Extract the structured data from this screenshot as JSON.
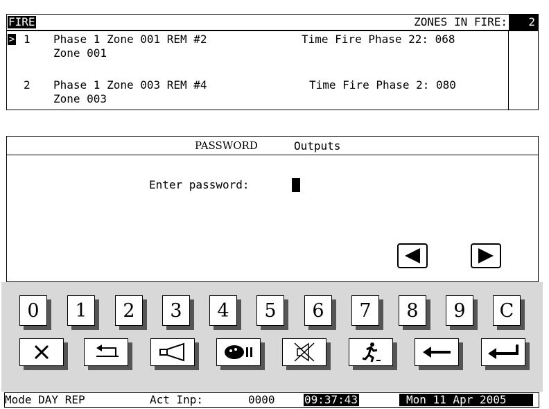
{
  "fire": {
    "label": "FIRE",
    "zones_label": "ZONES IN FIRE:",
    "zones_count": "2",
    "cursor": ">",
    "entries": [
      {
        "num": "1",
        "line1": "Phase 1 Zone 001 REM #2",
        "time": "Time Fire Phase 22: 068",
        "line2": "Zone 001"
      },
      {
        "num": "2",
        "line1": "Phase 1 Zone 003 REM #4",
        "time": "Time Fire Phase 2: 080",
        "line2": "Zone 003"
      }
    ]
  },
  "password": {
    "title": "PASSWORD",
    "subtitle": "Outputs",
    "prompt": "Enter password:"
  },
  "nav": {
    "left_icon": "left-triangle-icon",
    "right_icon": "right-triangle-icon"
  },
  "keypad": {
    "digits": [
      "0",
      "1",
      "2",
      "3",
      "4",
      "5",
      "6",
      "7",
      "8",
      "9",
      "C"
    ],
    "functions": [
      "close-x-icon",
      "return-arrow-icon",
      "horn-icon",
      "silence-bell-icon",
      "mute-speaker-icon",
      "evacuate-icon",
      "backspace-arrow-icon",
      "enter-arrow-icon"
    ]
  },
  "status": {
    "mode": "Mode DAY REP",
    "act_label": "Act Inp:",
    "act_value": "0000",
    "time": "09:37:43",
    "date": "Mon 11 Apr 2005"
  }
}
